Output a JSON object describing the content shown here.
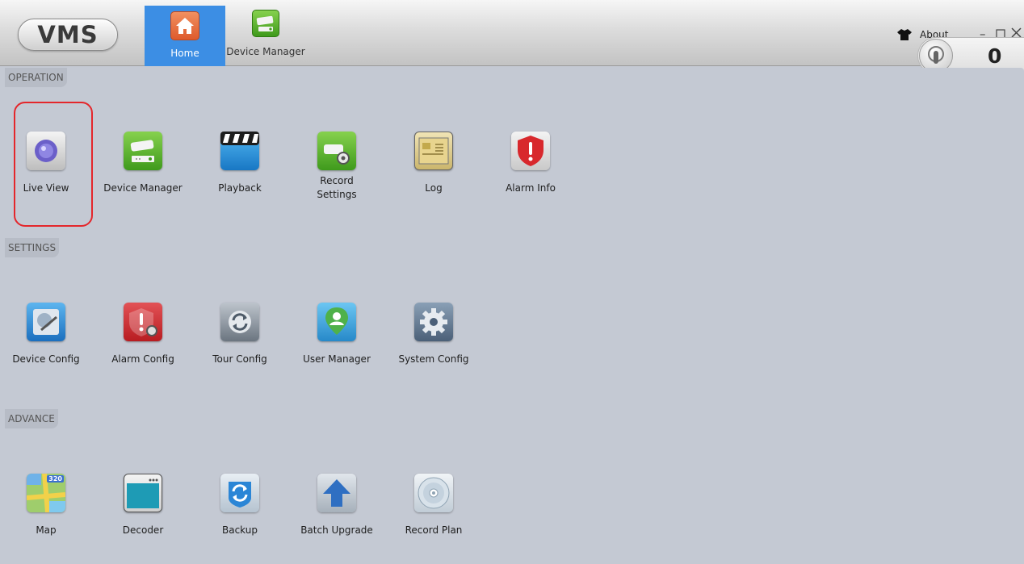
{
  "app": {
    "logo_text": "VMS"
  },
  "top_tabs": [
    {
      "label": "Home",
      "icon": "house-icon",
      "active": true
    },
    {
      "label": "Device Manager",
      "icon": "camera-icon",
      "active": false
    }
  ],
  "header": {
    "about_label": "About",
    "counter_value": "0"
  },
  "sections": {
    "operation": {
      "title": "OPERATION",
      "items": [
        {
          "label": "Live View",
          "icon": "live-view-camera-icon"
        },
        {
          "label": "Device Manager",
          "icon": "device-manager-icon"
        },
        {
          "label": "Playback",
          "icon": "clapperboard-icon"
        },
        {
          "label": "Record\nSettings",
          "icon": "record-settings-icon"
        },
        {
          "label": "Log",
          "icon": "log-icon"
        },
        {
          "label": "Alarm Info",
          "icon": "alarm-shield-icon"
        }
      ]
    },
    "settings": {
      "title": "SETTINGS",
      "items": [
        {
          "label": "Device Config",
          "icon": "device-config-icon"
        },
        {
          "label": "Alarm Config",
          "icon": "alarm-config-icon"
        },
        {
          "label": "Tour Config",
          "icon": "tour-config-icon"
        },
        {
          "label": "User Manager",
          "icon": "user-manager-icon"
        },
        {
          "label": "System Config",
          "icon": "system-config-gear-icon"
        }
      ]
    },
    "advance": {
      "title": "ADVANCE",
      "items": [
        {
          "label": "Map",
          "icon": "map-icon",
          "badge": "320"
        },
        {
          "label": "Decoder",
          "icon": "decoder-icon"
        },
        {
          "label": "Backup",
          "icon": "backup-icon"
        },
        {
          "label": "Batch Upgrade",
          "icon": "upload-arrow-icon"
        },
        {
          "label": "Record Plan",
          "icon": "disc-icon"
        }
      ]
    }
  },
  "colors": {
    "active_tab": "#3c8ee4",
    "highlight_border": "#e4262b",
    "panel_bg": "#c4c9d3"
  }
}
